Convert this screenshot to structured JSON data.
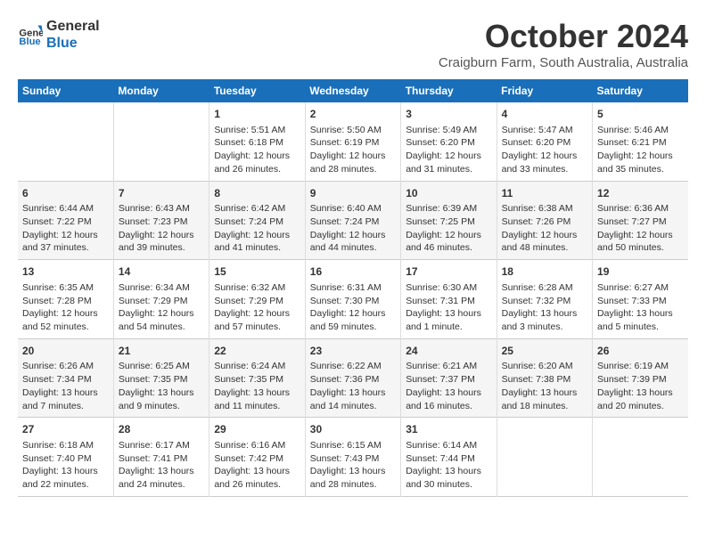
{
  "logo": {
    "line1": "General",
    "line2": "Blue"
  },
  "title": "October 2024",
  "subtitle": "Craigburn Farm, South Australia, Australia",
  "days": [
    "Sunday",
    "Monday",
    "Tuesday",
    "Wednesday",
    "Thursday",
    "Friday",
    "Saturday"
  ],
  "weeks": [
    [
      {
        "num": "",
        "text": ""
      },
      {
        "num": "",
        "text": ""
      },
      {
        "num": "1",
        "text": "Sunrise: 5:51 AM\nSunset: 6:18 PM\nDaylight: 12 hours and 26 minutes."
      },
      {
        "num": "2",
        "text": "Sunrise: 5:50 AM\nSunset: 6:19 PM\nDaylight: 12 hours and 28 minutes."
      },
      {
        "num": "3",
        "text": "Sunrise: 5:49 AM\nSunset: 6:20 PM\nDaylight: 12 hours and 31 minutes."
      },
      {
        "num": "4",
        "text": "Sunrise: 5:47 AM\nSunset: 6:20 PM\nDaylight: 12 hours and 33 minutes."
      },
      {
        "num": "5",
        "text": "Sunrise: 5:46 AM\nSunset: 6:21 PM\nDaylight: 12 hours and 35 minutes."
      }
    ],
    [
      {
        "num": "6",
        "text": "Sunrise: 6:44 AM\nSunset: 7:22 PM\nDaylight: 12 hours and 37 minutes."
      },
      {
        "num": "7",
        "text": "Sunrise: 6:43 AM\nSunset: 7:23 PM\nDaylight: 12 hours and 39 minutes."
      },
      {
        "num": "8",
        "text": "Sunrise: 6:42 AM\nSunset: 7:24 PM\nDaylight: 12 hours and 41 minutes."
      },
      {
        "num": "9",
        "text": "Sunrise: 6:40 AM\nSunset: 7:24 PM\nDaylight: 12 hours and 44 minutes."
      },
      {
        "num": "10",
        "text": "Sunrise: 6:39 AM\nSunset: 7:25 PM\nDaylight: 12 hours and 46 minutes."
      },
      {
        "num": "11",
        "text": "Sunrise: 6:38 AM\nSunset: 7:26 PM\nDaylight: 12 hours and 48 minutes."
      },
      {
        "num": "12",
        "text": "Sunrise: 6:36 AM\nSunset: 7:27 PM\nDaylight: 12 hours and 50 minutes."
      }
    ],
    [
      {
        "num": "13",
        "text": "Sunrise: 6:35 AM\nSunset: 7:28 PM\nDaylight: 12 hours and 52 minutes."
      },
      {
        "num": "14",
        "text": "Sunrise: 6:34 AM\nSunset: 7:29 PM\nDaylight: 12 hours and 54 minutes."
      },
      {
        "num": "15",
        "text": "Sunrise: 6:32 AM\nSunset: 7:29 PM\nDaylight: 12 hours and 57 minutes."
      },
      {
        "num": "16",
        "text": "Sunrise: 6:31 AM\nSunset: 7:30 PM\nDaylight: 12 hours and 59 minutes."
      },
      {
        "num": "17",
        "text": "Sunrise: 6:30 AM\nSunset: 7:31 PM\nDaylight: 13 hours and 1 minute."
      },
      {
        "num": "18",
        "text": "Sunrise: 6:28 AM\nSunset: 7:32 PM\nDaylight: 13 hours and 3 minutes."
      },
      {
        "num": "19",
        "text": "Sunrise: 6:27 AM\nSunset: 7:33 PM\nDaylight: 13 hours and 5 minutes."
      }
    ],
    [
      {
        "num": "20",
        "text": "Sunrise: 6:26 AM\nSunset: 7:34 PM\nDaylight: 13 hours and 7 minutes."
      },
      {
        "num": "21",
        "text": "Sunrise: 6:25 AM\nSunset: 7:35 PM\nDaylight: 13 hours and 9 minutes."
      },
      {
        "num": "22",
        "text": "Sunrise: 6:24 AM\nSunset: 7:35 PM\nDaylight: 13 hours and 11 minutes."
      },
      {
        "num": "23",
        "text": "Sunrise: 6:22 AM\nSunset: 7:36 PM\nDaylight: 13 hours and 14 minutes."
      },
      {
        "num": "24",
        "text": "Sunrise: 6:21 AM\nSunset: 7:37 PM\nDaylight: 13 hours and 16 minutes."
      },
      {
        "num": "25",
        "text": "Sunrise: 6:20 AM\nSunset: 7:38 PM\nDaylight: 13 hours and 18 minutes."
      },
      {
        "num": "26",
        "text": "Sunrise: 6:19 AM\nSunset: 7:39 PM\nDaylight: 13 hours and 20 minutes."
      }
    ],
    [
      {
        "num": "27",
        "text": "Sunrise: 6:18 AM\nSunset: 7:40 PM\nDaylight: 13 hours and 22 minutes."
      },
      {
        "num": "28",
        "text": "Sunrise: 6:17 AM\nSunset: 7:41 PM\nDaylight: 13 hours and 24 minutes."
      },
      {
        "num": "29",
        "text": "Sunrise: 6:16 AM\nSunset: 7:42 PM\nDaylight: 13 hours and 26 minutes."
      },
      {
        "num": "30",
        "text": "Sunrise: 6:15 AM\nSunset: 7:43 PM\nDaylight: 13 hours and 28 minutes."
      },
      {
        "num": "31",
        "text": "Sunrise: 6:14 AM\nSunset: 7:44 PM\nDaylight: 13 hours and 30 minutes."
      },
      {
        "num": "",
        "text": ""
      },
      {
        "num": "",
        "text": ""
      }
    ]
  ]
}
